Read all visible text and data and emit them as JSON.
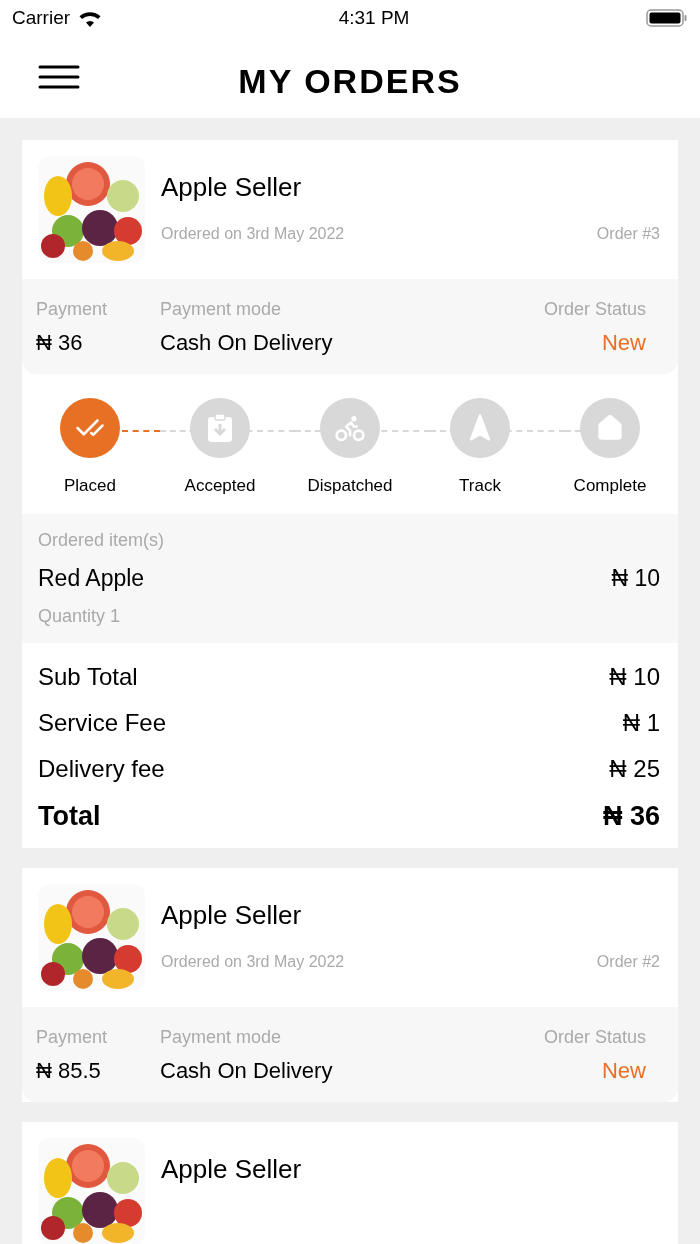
{
  "status_bar": {
    "carrier": "Carrier",
    "time": "4:31 PM"
  },
  "header": {
    "title": "MY ORDERS"
  },
  "orders": [
    {
      "seller": "Apple Seller",
      "date": "Ordered on 3rd May 2022",
      "order_no": "Order #3",
      "payment_label": "Payment",
      "payment": "₦ 36",
      "mode_label": "Payment mode",
      "mode": "Cash On Delivery",
      "status_label": "Order Status",
      "status": "New",
      "steps": [
        {
          "label": "Placed",
          "done": true
        },
        {
          "label": "Accepted",
          "done": false
        },
        {
          "label": "Dispatched",
          "done": false
        },
        {
          "label": "Track",
          "done": false
        },
        {
          "label": "Complete",
          "done": false
        }
      ],
      "items_label": "Ordered item(s)",
      "items": [
        {
          "name": "Red Apple",
          "price": "₦ 10",
          "quantity": "Quantity 1"
        }
      ],
      "totals": [
        {
          "label": "Sub Total",
          "value": "₦ 10",
          "kind": "line"
        },
        {
          "label": "Service Fee",
          "value": "₦ 1",
          "kind": "line"
        },
        {
          "label": "Delivery fee",
          "value": "₦ 25",
          "kind": "line"
        },
        {
          "label": "Total",
          "value": "₦ 36",
          "kind": "grand"
        }
      ]
    },
    {
      "seller": "Apple Seller",
      "date": "Ordered on 3rd May 2022",
      "order_no": "Order #2",
      "payment_label": "Payment",
      "payment": "₦ 85.5",
      "mode_label": "Payment mode",
      "mode": "Cash On Delivery",
      "status_label": "Order Status",
      "status": "New"
    },
    {
      "seller": "Apple Seller"
    }
  ]
}
